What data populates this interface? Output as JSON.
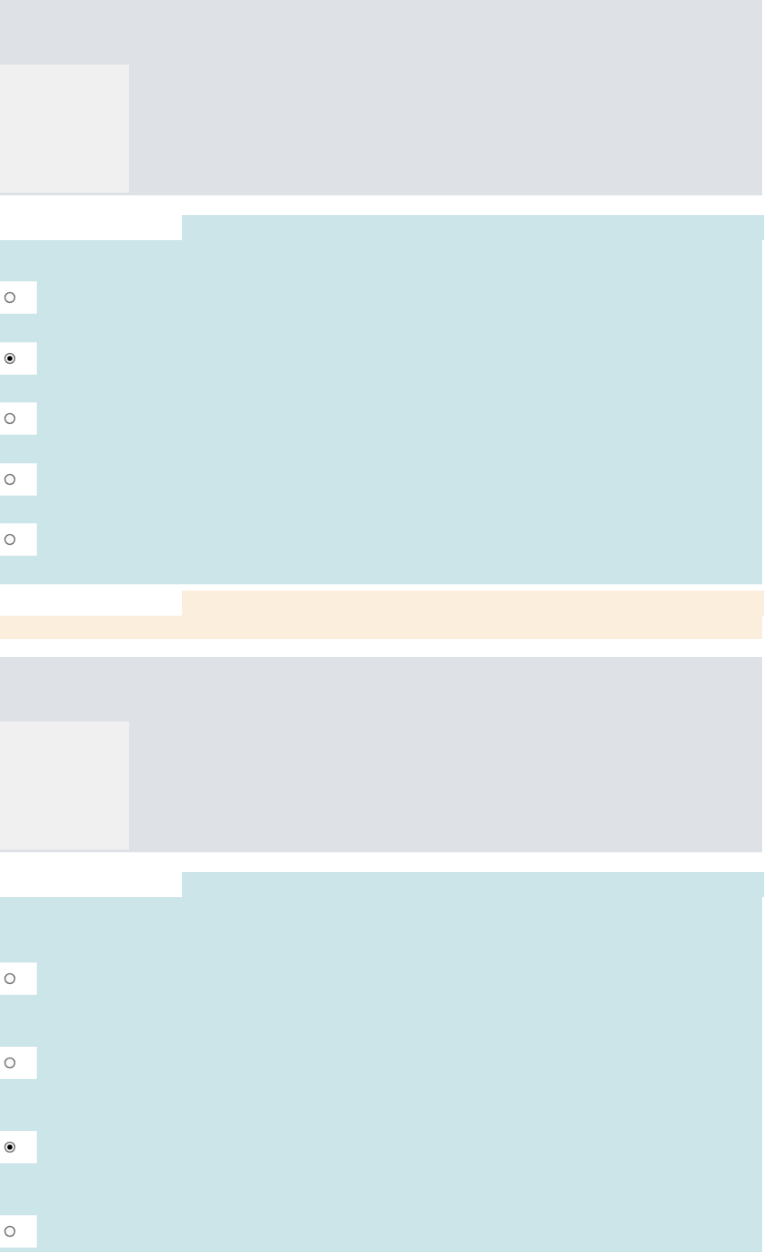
{
  "questions": [
    {
      "options": [
        {
          "selected": false
        },
        {
          "selected": true
        },
        {
          "selected": false
        },
        {
          "selected": false
        },
        {
          "selected": false
        }
      ]
    },
    {
      "options": [
        {
          "selected": false
        },
        {
          "selected": false
        },
        {
          "selected": true
        },
        {
          "selected": false
        }
      ]
    }
  ]
}
